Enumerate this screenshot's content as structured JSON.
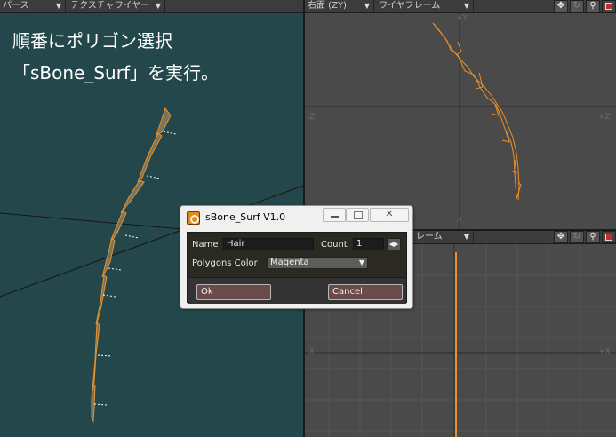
{
  "left_viewport": {
    "view_mode": "パース",
    "shading_mode": "テクスチャワイヤー",
    "caption_line1": "順番にポリゴン選択",
    "caption_line2": "「sBone_Surf」を実行。"
  },
  "top_right_viewport": {
    "view_mode": "右面 (ZY)",
    "shading_mode": "ワイヤフレーム",
    "axis_top": "+Y",
    "axis_left": "-Z",
    "axis_right": "+Z",
    "axis_bottom": "-Y"
  },
  "bottom_right_viewport": {
    "view_mode": "",
    "shading_mode": "レーム",
    "axis_left": "-X",
    "axis_right": "+X"
  },
  "viewport_icons": [
    "move-view-icon",
    "rotate-view-icon",
    "zoom-view-icon",
    "maximize-view-icon"
  ],
  "dialog": {
    "title": "sBone_Surf V1.0",
    "name_label": "Name",
    "name_value": "Hair",
    "count_label": "Count",
    "count_value": "1",
    "color_label": "Polygons Color",
    "color_value": "Magenta",
    "ok_label": "Ok",
    "cancel_label": "Cancel"
  },
  "colors": {
    "perspective_bg": "#23474a",
    "ortho_bg": "#4a4a4a",
    "polygon_outline": "#e8902a"
  }
}
